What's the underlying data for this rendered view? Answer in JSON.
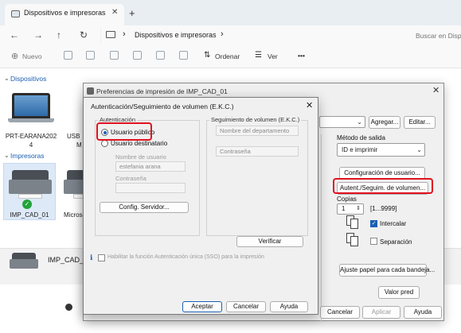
{
  "explorer": {
    "tab_title": "Dispositivos e impresoras",
    "tab_close": "✕",
    "tab_add": "+",
    "nav": {
      "back": "←",
      "forward": "→",
      "up": "↑",
      "refresh": "↻"
    },
    "address": {
      "chevron": "›",
      "path": "Dispositivos e impresoras"
    },
    "search_placeholder": "Buscar en Dispositivos e impresoras",
    "commands": {
      "new": "Nuevo",
      "sort": "Ordenar",
      "view": "Ver",
      "more": "•••"
    },
    "sections": {
      "devices": "Dispositivos",
      "printers": "Impresoras"
    },
    "devices": [
      {
        "label": "PRT-EARANA2024",
        "label_line1": "PRT-EARANA202",
        "label_line2": "4"
      },
      {
        "label_line1": "USB",
        "label_line2": "M"
      }
    ],
    "printers": [
      {
        "label": "IMP_CAD_01"
      },
      {
        "label": "Microso"
      }
    ],
    "details_name": "IMP_CAD_..."
  },
  "prefs": {
    "title": "Preferencias de impresión de IMP_CAD_01",
    "close": "✕",
    "agregar": "Agregar...",
    "editar": "Editar...",
    "metodo_label": "Método de salida",
    "metodo_value": "ID e imprimir",
    "config_usuario": "Configuración de usuario...",
    "autent_button": "Autent./Seguim. de volumen...",
    "copias_label": "Copias",
    "copias_value": "1",
    "copias_range": "[1...9999]",
    "intercalar": "Intercalar",
    "intercalar_checked": true,
    "separacion": "Separación",
    "separacion_checked": false,
    "ajuste": "Ajuste papel para cada bandeja...",
    "valor_pred": "Valor pred",
    "cancelar": "Cancelar",
    "aplicar": "Aplicar",
    "ayuda": "Ayuda"
  },
  "auth": {
    "title": "Autenticación/Seguimiento de volumen (E.K.C.)",
    "close": "✕",
    "auth_group": "Autenticación",
    "usuario_publico": "Usuario público",
    "usuario_destinatario": "Usuario destinatario",
    "nombre_usuario_label": "Nombre de usuario",
    "nombre_usuario_value": "estefania arana",
    "contrasena_label": "Contraseña",
    "config_servidor": "Config. Servidor...",
    "tracking_group": "Seguimiento de volumen (E.K.C.)",
    "nombre_departamento": "Nombre del departamento",
    "contrasena2_label": "Contraseña",
    "verificar": "Verificar",
    "sso_label": "Habilitar la función Autenticación única (SSO) para la impresión",
    "sso_checked": false,
    "aceptar": "Aceptar",
    "cancelar": "Cancelar",
    "ayuda": "Ayuda"
  },
  "colors": {
    "highlight_red": "#e0131f",
    "accent_blue": "#1a5fb4",
    "selected_bg": "#dde9f7"
  }
}
